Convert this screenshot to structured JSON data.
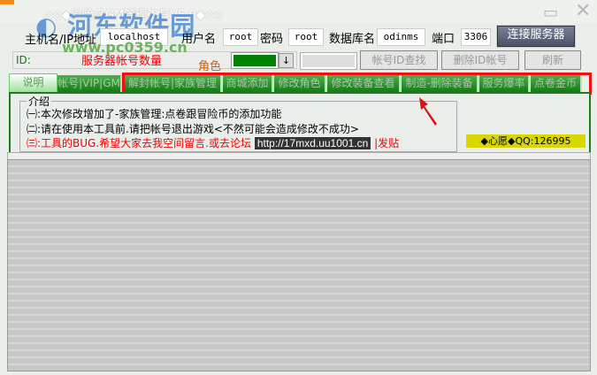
{
  "window": {
    "title": "◇◇◆冒险岛GM管理工具V5.0◆◇◇",
    "watermark": "河东软件园",
    "watermark_url": "www.pc0359.cn"
  },
  "connection": {
    "host_label": "主机名/IP地址",
    "host_value": "localhost",
    "user_label": "用户名",
    "user_value": "root",
    "password_label": "密码",
    "password_value": "root",
    "db_label": "数据库名",
    "db_value": "odinms",
    "port_label": "端口",
    "port_value": "3306",
    "connect_button": "连接服务器"
  },
  "account": {
    "id_label": "ID:",
    "server_count_label": "服务器帐号数量",
    "role_label": "角色",
    "find_button": "帐号ID查找",
    "delete_button": "删除ID帐号",
    "refresh_button": "刷新",
    "role_color": "#008000"
  },
  "tabs": [
    {
      "label": "说明"
    },
    {
      "label": "帐号|VIP|GM"
    },
    {
      "label": "解封帐号|家族管理"
    },
    {
      "label": "商城添加"
    },
    {
      "label": "修改角色"
    },
    {
      "label": "修改装备查看"
    },
    {
      "label": "制造-删除装备"
    },
    {
      "label": "服务爆率"
    },
    {
      "label": "点卷金币"
    }
  ],
  "intro": {
    "title": "介绍",
    "line1": "㈠:本次修改增加了-家族管理:点卷跟冒险币的添加功能",
    "line2": "㈡:请在使用本工具前.请把帐号退出游戏<不然可能会造成修改不成功>",
    "line3": "㈢:工具的BUG.希望大家去我空间留言.或去论坛",
    "url": "http://17mxd.uu1001.cn",
    "line3_end": "|发贴",
    "qq": "◆心愿◆QQ:126995"
  }
}
